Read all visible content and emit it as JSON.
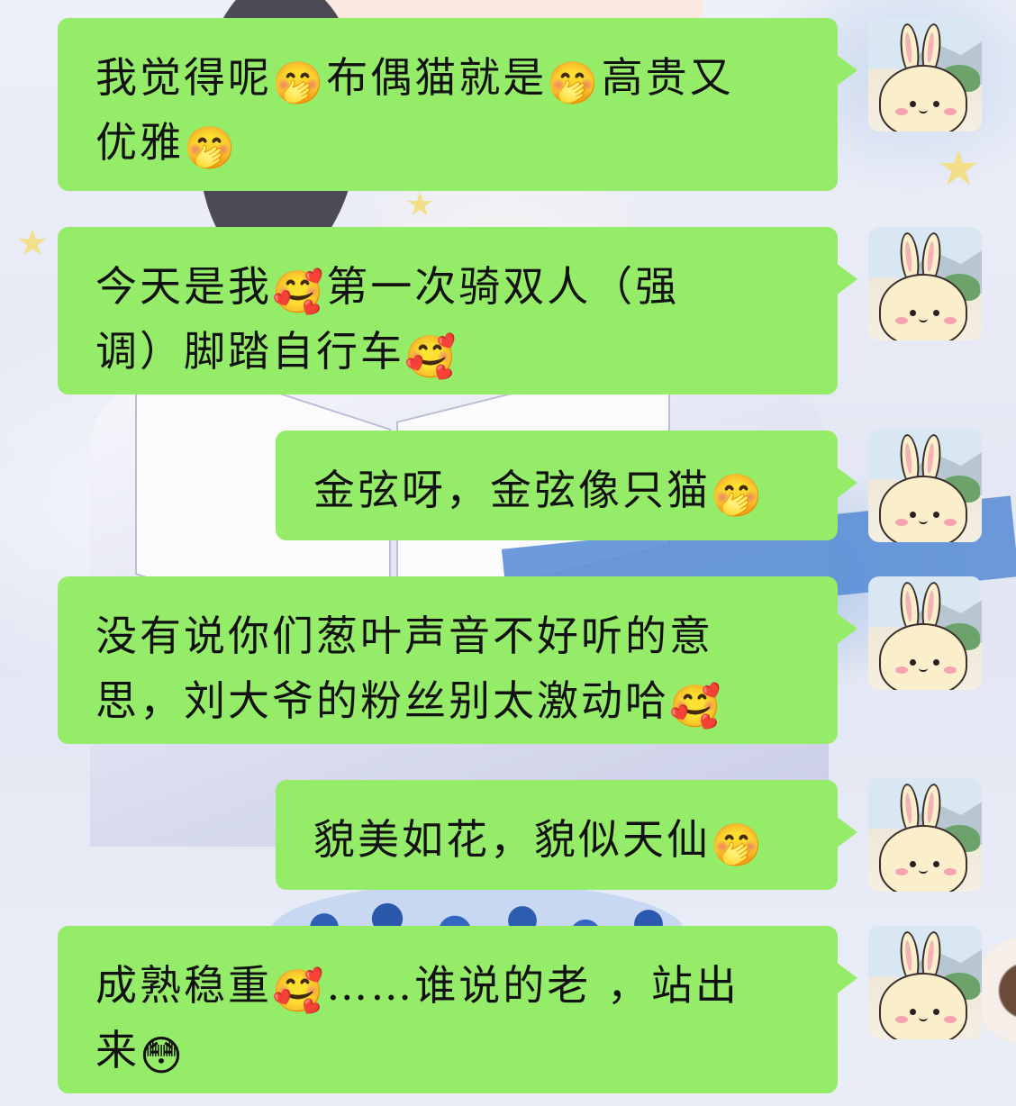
{
  "messages": [
    {
      "sender": "me",
      "lines": [
        [
          {
            "t": "我觉得呢"
          },
          {
            "e": "🤭"
          },
          {
            "t": "布偶猫就是"
          },
          {
            "e": "🤭"
          },
          {
            "t": "高贵又"
          }
        ],
        [
          {
            "t": "优雅"
          },
          {
            "e": "🤭"
          }
        ]
      ]
    },
    {
      "sender": "me",
      "lines": [
        [
          {
            "t": "今天是我"
          },
          {
            "e": "🥰"
          },
          {
            "t": "第一次骑双人（强"
          }
        ],
        [
          {
            "t": "调）脚踏自行车"
          },
          {
            "e": "🥰"
          }
        ]
      ]
    },
    {
      "sender": "me",
      "lines": [
        [
          {
            "t": "金弦呀，金弦像只猫"
          },
          {
            "e": "🤭"
          }
        ]
      ]
    },
    {
      "sender": "me",
      "lines": [
        [
          {
            "t": "没有说你们葱叶声音不好听的意"
          }
        ],
        [
          {
            "t": "思，刘大爷的粉丝别太激动哈"
          },
          {
            "e": "🥰"
          }
        ]
      ]
    },
    {
      "sender": "me",
      "lines": [
        [
          {
            "t": "貌美如花，貌似天仙"
          },
          {
            "e": "🤭"
          }
        ]
      ]
    },
    {
      "sender": "me",
      "lines": [
        [
          {
            "t": "成熟稳重"
          },
          {
            "e": "🥰"
          },
          {
            "t": "……谁说的老 ，站出"
          }
        ],
        [
          {
            "t": "来"
          },
          {
            "e": "😳"
          }
        ]
      ]
    }
  ],
  "avatar": {
    "icon": "bunny-avatar-icon"
  },
  "colors": {
    "bubble": "#95ec69",
    "text": "#111111"
  }
}
